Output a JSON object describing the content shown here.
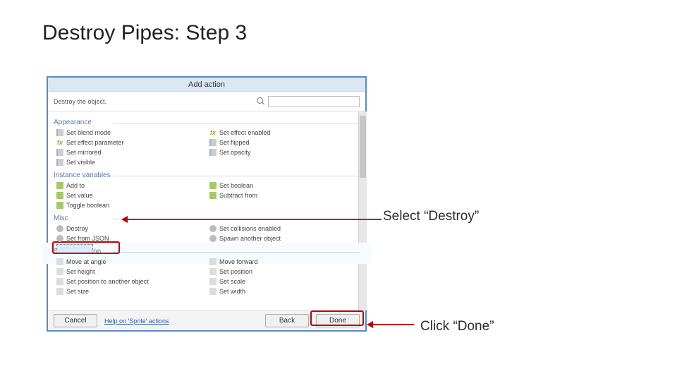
{
  "slide": {
    "title": "Destroy Pipes: Step 3"
  },
  "dialog": {
    "title": "Add action",
    "description": "Destroy the object.",
    "search_placeholder": ""
  },
  "groups": {
    "appearance": {
      "header": "Appearance",
      "left": [
        "Set blend mode",
        "Set effect parameter",
        "Set mirrored",
        "Set visible"
      ],
      "right": [
        "Set effect enabled",
        "Set flipped",
        "Set opacity"
      ]
    },
    "instance": {
      "header": "Instance variables",
      "left": [
        "Add to",
        "Set value",
        "Toggle boolean"
      ],
      "right": [
        "Set boolean",
        "Subtract from"
      ]
    },
    "misc": {
      "header": "Misc",
      "left": [
        "Destroy",
        "Set from JSON"
      ],
      "right": [
        "Set collisions enabled",
        "Spawn another object"
      ]
    },
    "sizepos": {
      "header": "Size & Position",
      "left": [
        "Move at angle",
        "Set height",
        "Set position to another object",
        "Set size"
      ],
      "right": [
        "Move forward",
        "Set position",
        "Set scale",
        "Set width"
      ]
    }
  },
  "footer": {
    "cancel": "Cancel",
    "help": "Help on 'Sprite' actions",
    "back": "Back",
    "done": "Done"
  },
  "callouts": {
    "select": "Select “Destroy”",
    "done": "Click “Done”"
  }
}
